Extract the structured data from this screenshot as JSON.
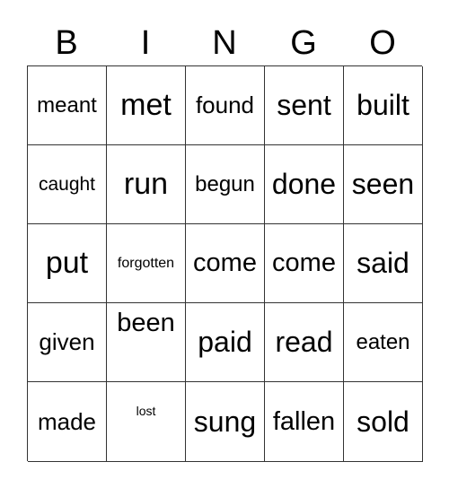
{
  "header": [
    "B",
    "I",
    "N",
    "G",
    "O"
  ],
  "cells": [
    [
      "meant",
      "met",
      "found",
      "sent",
      "built"
    ],
    [
      "caught",
      "run",
      "begun",
      "done",
      "seen"
    ],
    [
      "put",
      "forgotten",
      "come",
      "come",
      "said"
    ],
    [
      "given",
      "been",
      "paid",
      "read",
      "eaten"
    ],
    [
      "made",
      "lost",
      "sung",
      "fallen",
      "sold"
    ]
  ]
}
